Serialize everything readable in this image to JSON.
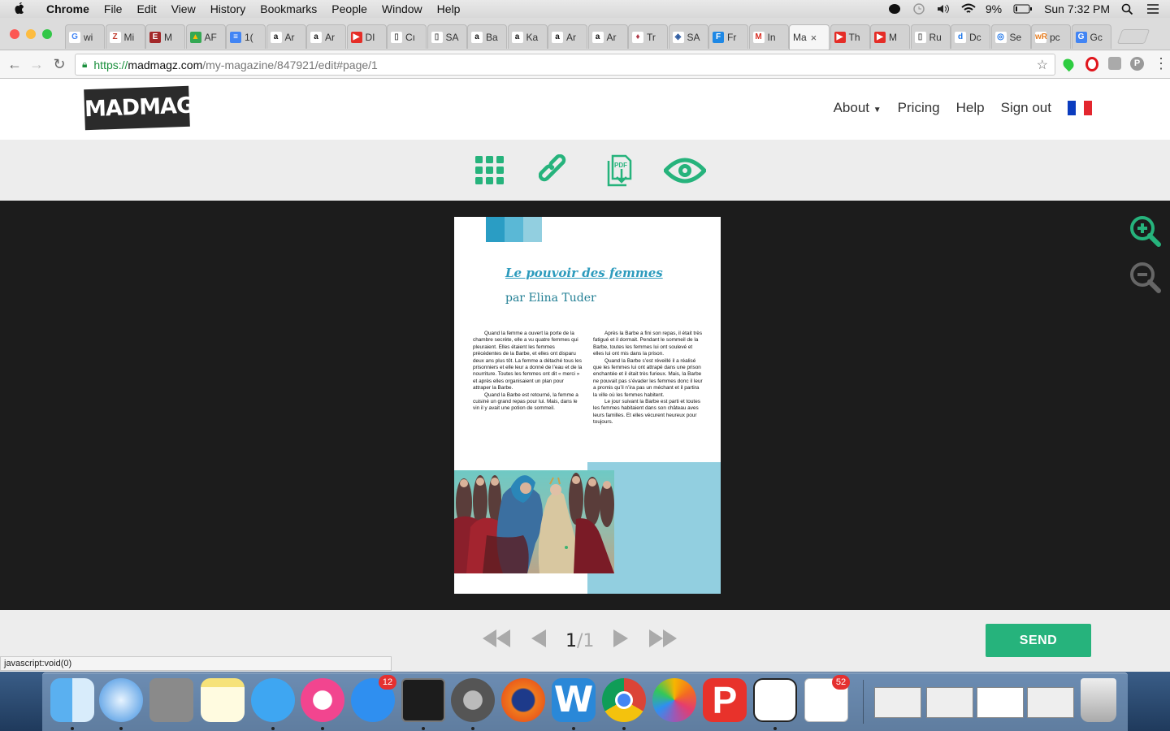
{
  "menubar": {
    "app_name": "Chrome",
    "menus": [
      "File",
      "Edit",
      "View",
      "History",
      "Bookmarks",
      "People",
      "Window",
      "Help"
    ],
    "battery": "9%",
    "clock": "Sun 7:32 PM"
  },
  "tabs": [
    {
      "label": "wi",
      "fav_color": "#fff",
      "fav_text": "G",
      "fav_fg": "#4285f4"
    },
    {
      "label": "Mi",
      "fav_color": "#fff",
      "fav_text": "Z",
      "fav_fg": "#c0392b"
    },
    {
      "label": "M",
      "fav_color": "#a3282a",
      "fav_text": "E",
      "fav_fg": "#fff"
    },
    {
      "label": "AF",
      "fav_color": "#34a853",
      "fav_text": "▲",
      "fav_fg": "#fbbc05"
    },
    {
      "label": "1(",
      "fav_color": "#4285f4",
      "fav_text": "≡",
      "fav_fg": "#fff"
    },
    {
      "label": "Ar",
      "fav_color": "#fff",
      "fav_text": "a",
      "fav_fg": "#111"
    },
    {
      "label": "Ar",
      "fav_color": "#fff",
      "fav_text": "a",
      "fav_fg": "#111"
    },
    {
      "label": "DI",
      "fav_color": "#e52d27",
      "fav_text": "▶",
      "fav_fg": "#fff"
    },
    {
      "label": "Cı",
      "fav_color": "#fff",
      "fav_text": "▯",
      "fav_fg": "#555"
    },
    {
      "label": "SA",
      "fav_color": "#fff",
      "fav_text": "▯",
      "fav_fg": "#555"
    },
    {
      "label": "Ba",
      "fav_color": "#fff",
      "fav_text": "a",
      "fav_fg": "#111"
    },
    {
      "label": "Ka",
      "fav_color": "#fff",
      "fav_text": "a",
      "fav_fg": "#111"
    },
    {
      "label": "Ar",
      "fav_color": "#fff",
      "fav_text": "a",
      "fav_fg": "#111"
    },
    {
      "label": "Ar",
      "fav_color": "#fff",
      "fav_text": "a",
      "fav_fg": "#111"
    },
    {
      "label": "Tr",
      "fav_color": "#fff",
      "fav_text": "♦",
      "fav_fg": "#b03a48"
    },
    {
      "label": "SA",
      "fav_color": "#fff",
      "fav_text": "◈",
      "fav_fg": "#2c5aa0"
    },
    {
      "label": "Fr",
      "fav_color": "#1e88e5",
      "fav_text": "F",
      "fav_fg": "#fff"
    },
    {
      "label": "In",
      "fav_color": "#fff",
      "fav_text": "M",
      "fav_fg": "#d93025"
    },
    {
      "label": "Ma",
      "fav_color": "",
      "fav_text": "",
      "fav_fg": "#111",
      "active": true
    },
    {
      "label": "Th",
      "fav_color": "#e52d27",
      "fav_text": "▶",
      "fav_fg": "#fff"
    },
    {
      "label": "M",
      "fav_color": "#e52d27",
      "fav_text": "▶",
      "fav_fg": "#fff"
    },
    {
      "label": "Ru",
      "fav_color": "#fff",
      "fav_text": "▯",
      "fav_fg": "#555"
    },
    {
      "label": "Dc",
      "fav_color": "#fff",
      "fav_text": "d",
      "fav_fg": "#1a73e8"
    },
    {
      "label": "Se",
      "fav_color": "#fff",
      "fav_text": "◎",
      "fav_fg": "#1a73e8"
    },
    {
      "label": "pc",
      "fav_color": "#fff",
      "fav_text": "wR",
      "fav_fg": "#e67e22"
    },
    {
      "label": "Gc",
      "fav_color": "#4285f4",
      "fav_text": "G",
      "fav_fg": "#fff"
    }
  ],
  "omnibox": {
    "scheme": "https://",
    "host": "madmagz.com",
    "path": "/my-magazine/847921/edit#page/1"
  },
  "site": {
    "logo": "MADMAGZ",
    "nav": {
      "about": "About",
      "pricing": "Pricing",
      "help": "Help",
      "signout": "Sign out"
    },
    "language_flag_colors": [
      "#0b3cbf",
      "#ffffff",
      "#e3262e"
    ]
  },
  "tools": [
    "grid-icon",
    "link-icon",
    "pdf-download-icon",
    "eye-preview-icon"
  ],
  "accent_color": "#26b37c",
  "magazine_page": {
    "title": "Le pouvoir des femmes",
    "author": "par Elina Tuder",
    "column1": [
      "Quand la femme a ouvert la porte de la chambre secrète, elle a vu quatre femmes qui pleuraient. Elles étaient les femmes précédentes de la Barbe, et elles ont disparu deux ans plus tôt. La femme a détaché tous les prisonniers et elle leur a donné de l’eau et de la nourriture. Toutes les femmes ont dit « merci » et après elles organisaient un plan pour attraper la Barbe.",
      "Quand la Barbe est retourné, la femme a cuisiné un grand repas pour lui. Mais, dans le vin il y avait une potion de sommeil."
    ],
    "column2": [
      "Après la Barbe a fini son repas, il était très fatigué et il dormait. Pendant le sommeil de la Barbe, toutes les femmes lui ont soulevé et elles lui ont mis dans la prison.",
      "Quand la Barbe s’est réveillé il a réalisé que les femmes lui ont attrapé dans une prison enchantée et il était très furieux. Mais, la Barbe ne pouvait pas s’évader les femmes donc il leur a promis qu’il n’ira pas un méchant et il partira la ville où les femmes habitent.",
      "Le jour suivant la Barbe est parti et toutes les femmes habitaient dans son château aves leurs familles. Et elles vécurent heureux pour toujours."
    ],
    "header_squares": [
      "#2a9dc4",
      "#5ab8d6",
      "#92cfe0"
    ]
  },
  "pagination": {
    "current": "1",
    "separator": "/",
    "total": "1"
  },
  "send_label": "SEND",
  "status_text": "javascript:void(0)",
  "dock": {
    "appstore_badge": "12",
    "reminders_badge": "52"
  }
}
